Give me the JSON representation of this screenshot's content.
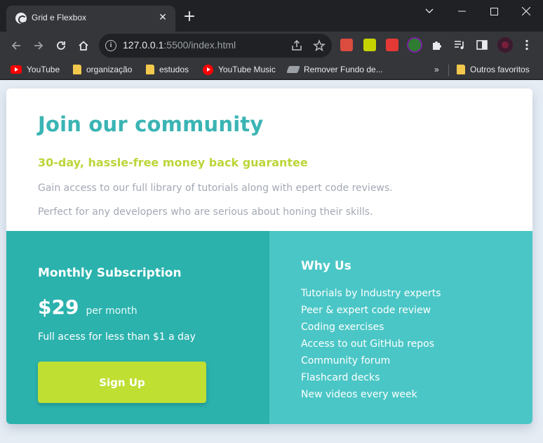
{
  "browser": {
    "tab_title": "Grid e Flexbox",
    "url_host": "127.0.0.1",
    "url_rest": ":5500/index.html",
    "bookmarks": [
      {
        "label": "YouTube",
        "icon": "youtube-icon"
      },
      {
        "label": "organização",
        "icon": "folder-icon"
      },
      {
        "label": "estudos",
        "icon": "folder-icon"
      },
      {
        "label": "YouTube Music",
        "icon": "youtube-music-icon"
      },
      {
        "label": "Remover Fundo de...",
        "icon": "layers-icon"
      }
    ],
    "overflow_label": "»",
    "other_bookmarks": "Outros favoritos"
  },
  "page": {
    "title": "Join our community",
    "subtitle": "30-day, hassle-free money back guarantee",
    "text1": "Gain access to our full library of tutorials along with epert code reviews.",
    "text2": "Perfect for any developers who are serious about honing their skills.",
    "subscription": {
      "title": "Monthly Subscription",
      "price": "$29",
      "period": "per month",
      "description": "Full acess for less than $1 a day",
      "button": "Sign Up"
    },
    "why": {
      "title": "Why Us",
      "items": [
        "Tutorials by Industry experts",
        "Peer & expert code review",
        "Coding exercises",
        "Access to out GitHub repos",
        "Community forum",
        "Flashcard decks",
        "New videos every week"
      ]
    }
  },
  "colors": {
    "title": "#3ab4b4",
    "subtitle": "#bcd539",
    "left_panel": "#2bb2ad",
    "right_panel": "#4bc6c6",
    "button": "#bfdf33",
    "background": "#e5ecf4"
  }
}
